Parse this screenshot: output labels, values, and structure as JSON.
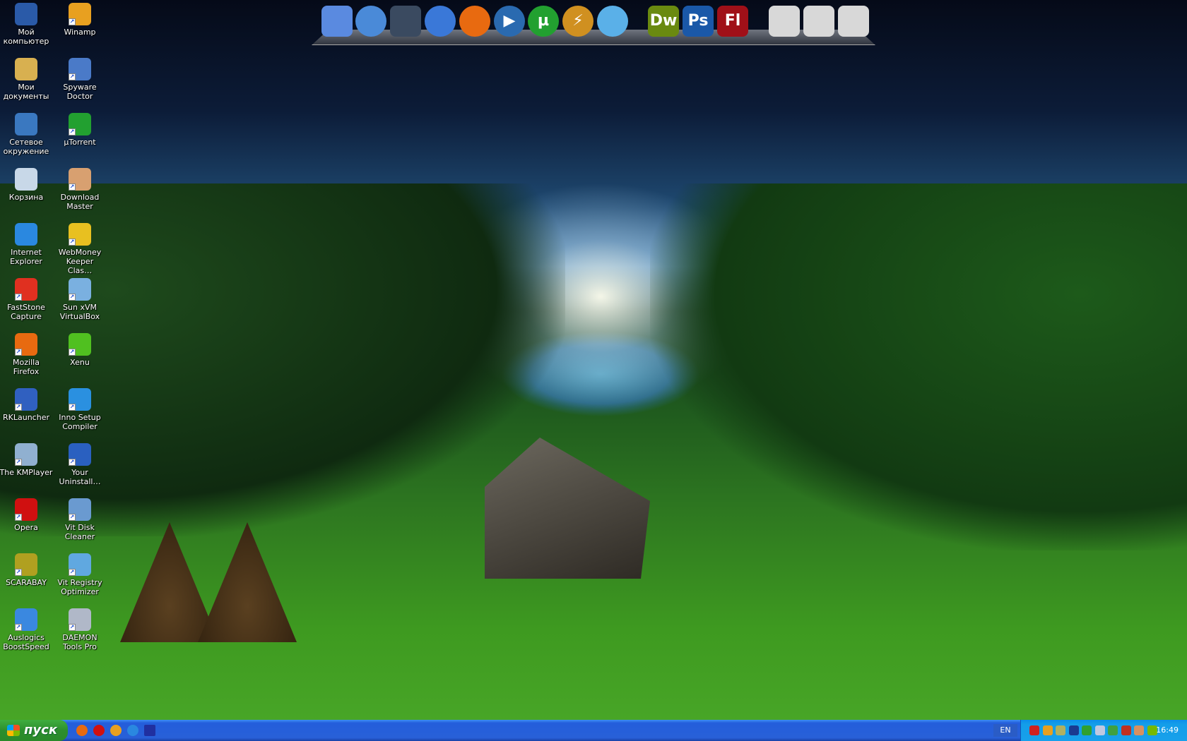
{
  "desktop_icons": [
    {
      "label": "Мой компьютер",
      "icon": "my-computer-icon",
      "color": "#2a5aa8",
      "shortcut": false
    },
    {
      "label": "Winamp",
      "icon": "winamp-icon",
      "color": "#e8a020",
      "shortcut": true
    },
    {
      "label": "Мои документы",
      "icon": "my-documents-icon",
      "color": "#d8b050",
      "shortcut": false
    },
    {
      "label": "Spyware Doctor",
      "icon": "spyware-doctor-icon",
      "color": "#4a7ac8",
      "shortcut": true
    },
    {
      "label": "Сетевое окружение",
      "icon": "network-icon",
      "color": "#3a78c0",
      "shortcut": false
    },
    {
      "label": "µTorrent",
      "icon": "utorrent-icon",
      "color": "#22a030",
      "shortcut": true
    },
    {
      "label": "Корзина",
      "icon": "recycle-bin-icon",
      "color": "#c8d8e8",
      "shortcut": false
    },
    {
      "label": "Download Master",
      "icon": "download-master-icon",
      "color": "#d8a070",
      "shortcut": true
    },
    {
      "label": "Internet Explorer",
      "icon": "internet-explorer-icon",
      "color": "#2a88e0",
      "shortcut": false
    },
    {
      "label": "WebMoney Keeper Clas…",
      "icon": "webmoney-icon",
      "color": "#e8c020",
      "shortcut": true
    },
    {
      "label": "FastStone Capture",
      "icon": "faststone-icon",
      "color": "#e03020",
      "shortcut": true
    },
    {
      "label": "Sun xVM VirtualBox",
      "icon": "virtualbox-icon",
      "color": "#7ab0e0",
      "shortcut": true
    },
    {
      "label": "Mozilla Firefox",
      "icon": "firefox-icon",
      "color": "#e86a10",
      "shortcut": true
    },
    {
      "label": "Xenu",
      "icon": "xenu-icon",
      "color": "#50c020",
      "shortcut": true
    },
    {
      "label": "RKLauncher",
      "icon": "rklauncher-icon",
      "color": "#3060c0",
      "shortcut": true
    },
    {
      "label": "Inno Setup Compiler",
      "icon": "inno-setup-icon",
      "color": "#2a90e0",
      "shortcut": true
    },
    {
      "label": "The KMPlayer",
      "icon": "kmplayer-icon",
      "color": "#90b0d0",
      "shortcut": true
    },
    {
      "label": "Your Uninstall…",
      "icon": "your-uninstaller-icon",
      "color": "#2a60c0",
      "shortcut": true
    },
    {
      "label": "Opera",
      "icon": "opera-icon",
      "color": "#d01010",
      "shortcut": true
    },
    {
      "label": "Vit Disk Cleaner",
      "icon": "vit-disk-cleaner-icon",
      "color": "#6a9ad0",
      "shortcut": true
    },
    {
      "label": "SCARABAY",
      "icon": "scarabay-icon",
      "color": "#b0a020",
      "shortcut": true
    },
    {
      "label": "Vit Registry Optimizer",
      "icon": "vit-registry-icon",
      "color": "#60a8e0",
      "shortcut": true
    },
    {
      "label": "Auslogics BoostSpeed",
      "icon": "auslogics-icon",
      "color": "#3a88e0",
      "shortcut": true
    },
    {
      "label": "DAEMON Tools Pro",
      "icon": "daemon-tools-icon",
      "color": "#b0b8c8",
      "shortcut": true
    }
  ],
  "dock": {
    "items": [
      {
        "name": "finder-icon",
        "text": "",
        "color": "#5a8ae0"
      },
      {
        "name": "safari-compass-icon",
        "text": "",
        "color": "#4a8ad8"
      },
      {
        "name": "dashboard-icon",
        "text": "",
        "color": "#3a4a60"
      },
      {
        "name": "globe-icon",
        "text": "",
        "color": "#3a78d8"
      },
      {
        "name": "firefox-icon",
        "text": "",
        "color": "#e86a10"
      },
      {
        "name": "media-player-icon",
        "text": "▶",
        "color": "#2a6ab0"
      },
      {
        "name": "utorrent-icon",
        "text": "µ",
        "color": "#22a030"
      },
      {
        "name": "winamp-icon",
        "text": "⚡",
        "color": "#d09020"
      },
      {
        "name": "messenger-icon",
        "text": "",
        "color": "#5ab0e8"
      },
      {
        "name": "dreamweaver-icon",
        "text": "Dw",
        "color": "#6a8a10"
      },
      {
        "name": "photoshop-icon",
        "text": "Ps",
        "color": "#1a58a8"
      },
      {
        "name": "flash-icon",
        "text": "Fl",
        "color": "#a01018"
      },
      {
        "name": "usb-drive-icon",
        "text": "",
        "color": "#d8d8d8"
      },
      {
        "name": "drive-eject-icon",
        "text": "",
        "color": "#d8d8d8"
      },
      {
        "name": "drive-icon",
        "text": "",
        "color": "#d8d8d8"
      }
    ]
  },
  "taskbar": {
    "start_label": "пуск",
    "quick_launch": [
      {
        "name": "firefox-icon",
        "color": "#e86a10"
      },
      {
        "name": "opera-icon",
        "color": "#d01010"
      },
      {
        "name": "winamp-icon",
        "color": "#e8a020"
      },
      {
        "name": "internet-explorer-icon",
        "color": "#2a88e0"
      },
      {
        "name": "show-desktop-icon",
        "color": "#2030a0"
      }
    ],
    "language": "EN",
    "tray_icons": [
      {
        "name": "faststone-tray-icon",
        "color": "#d02020"
      },
      {
        "name": "winamp-tray-icon",
        "color": "#e8a020"
      },
      {
        "name": "webmoney-tray-icon",
        "color": "#b0b060"
      },
      {
        "name": "network-tray-icon",
        "color": "#1a3a90"
      },
      {
        "name": "green-circle-tray-icon",
        "color": "#30a030"
      },
      {
        "name": "daemon-tray-icon",
        "color": "#c0c8e0"
      },
      {
        "name": "safely-remove-tray-icon",
        "color": "#40a040"
      },
      {
        "name": "volume-icon",
        "color": "#c03020"
      },
      {
        "name": "download-master-tray-icon",
        "color": "#d89060"
      },
      {
        "name": "nvidia-icon",
        "color": "#76b900"
      }
    ],
    "clock": "16:49"
  }
}
